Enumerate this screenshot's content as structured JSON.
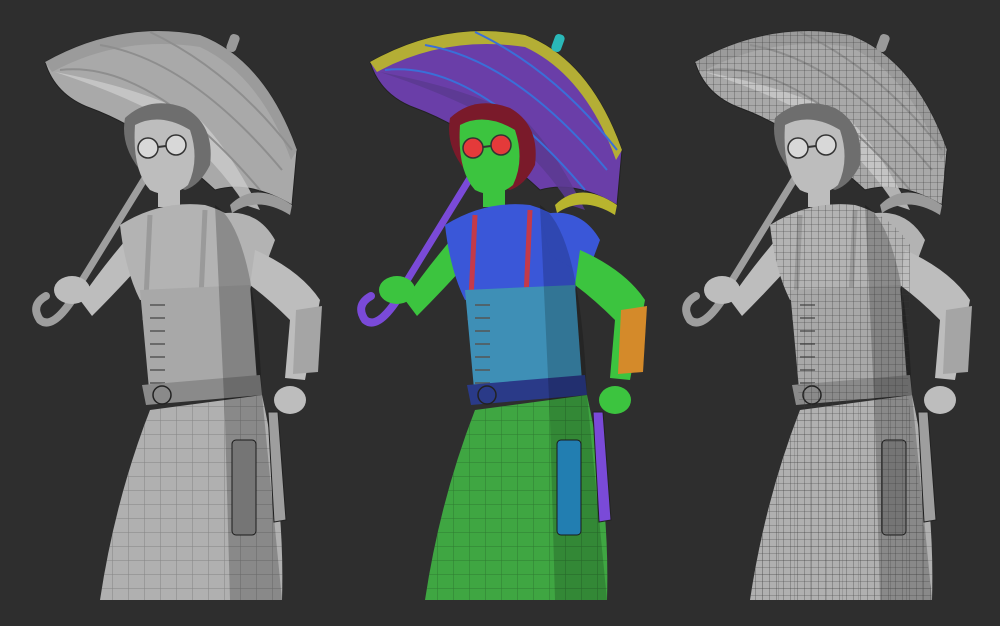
{
  "scene": {
    "background": "#2e2e2e",
    "views": [
      {
        "name": "sculpt-view",
        "shading": "clay",
        "wireframe": false
      },
      {
        "name": "polygroups-view",
        "shading": "polygroups",
        "wireframe": false
      },
      {
        "name": "wireframe-view",
        "shading": "clay",
        "wireframe": true
      }
    ],
    "clay": {
      "skin": "#bdbdbd",
      "dress": "#b3b3b3",
      "dark": "#8a8a8a",
      "umbrella": "#a9a9a9",
      "umbrella_inner": "#c9c9c9",
      "handle": "#9e9e9e"
    },
    "polygroups": {
      "skin": "#3cc43f",
      "blouse": "#3a57d8",
      "corset": "#3e8fb6",
      "skirt": "#3fa642",
      "umbrella_canopy": "#6a3ea8",
      "umbrella_band": "#b8b42e",
      "umbrella_rib": "#3a6fd8",
      "handle": "#7a4ad8",
      "hair": "#7a1a2a",
      "goggles": "#e43a3a",
      "belt": "#2a3a88",
      "straps": "#c43a4a",
      "bracer": "#d48a2a",
      "holster": "#2a9ad8",
      "tip": "#2ab8b8"
    }
  }
}
